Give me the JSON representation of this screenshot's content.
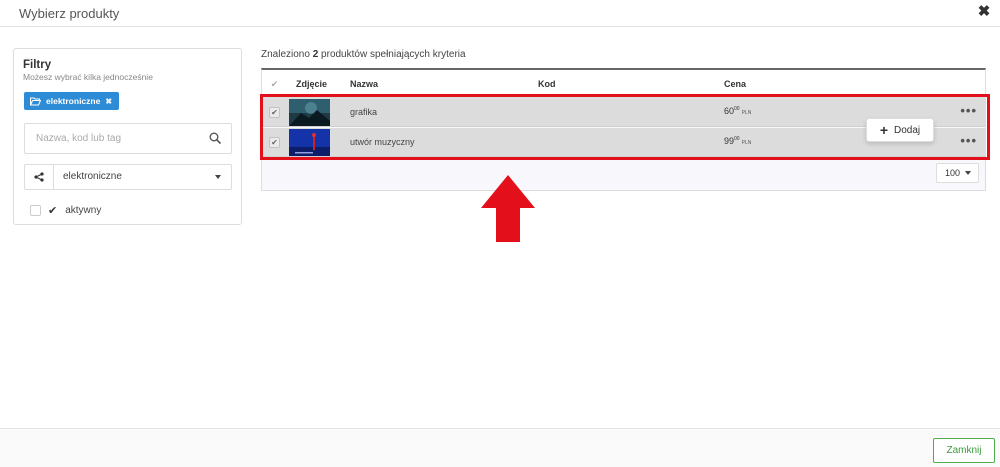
{
  "modal": {
    "title": "Wybierz produkty",
    "close_icon": "close-icon"
  },
  "filters": {
    "title": "Filtry",
    "subtitle": "Możesz wybrać kilka jednocześnie",
    "tag": {
      "label": "elektroniczne",
      "icon": "folder-open-icon"
    },
    "search": {
      "placeholder": "Nazwa, kod lub tag",
      "value": "",
      "icon": "search-icon"
    },
    "select": {
      "value": "elektroniczne",
      "icon": "share-icon"
    },
    "active": {
      "label": "aktywny",
      "checked": false
    }
  },
  "results": {
    "found_prefix": "Znaleziono",
    "found_count": "2",
    "found_suffix": "produktów spełniających kryteria",
    "columns": {
      "image": "Zdjęcie",
      "name": "Nazwa",
      "code": "Kod",
      "price": "Cena"
    },
    "rows": [
      {
        "name": "grafika",
        "code": "",
        "price_main": "60",
        "price_cents": "00",
        "currency": "PLN",
        "checked": true
      },
      {
        "name": "utwór muzyczny",
        "code": "",
        "price_main": "99",
        "price_cents": "00",
        "currency": "PLN",
        "checked": true
      }
    ],
    "add_button": "Dodaj",
    "per_page": "100"
  },
  "footer": {
    "close_button": "Zamknij"
  },
  "colors": {
    "accent": "#2e8bd6",
    "highlight": "#e3101c",
    "success": "#4cae4c"
  }
}
